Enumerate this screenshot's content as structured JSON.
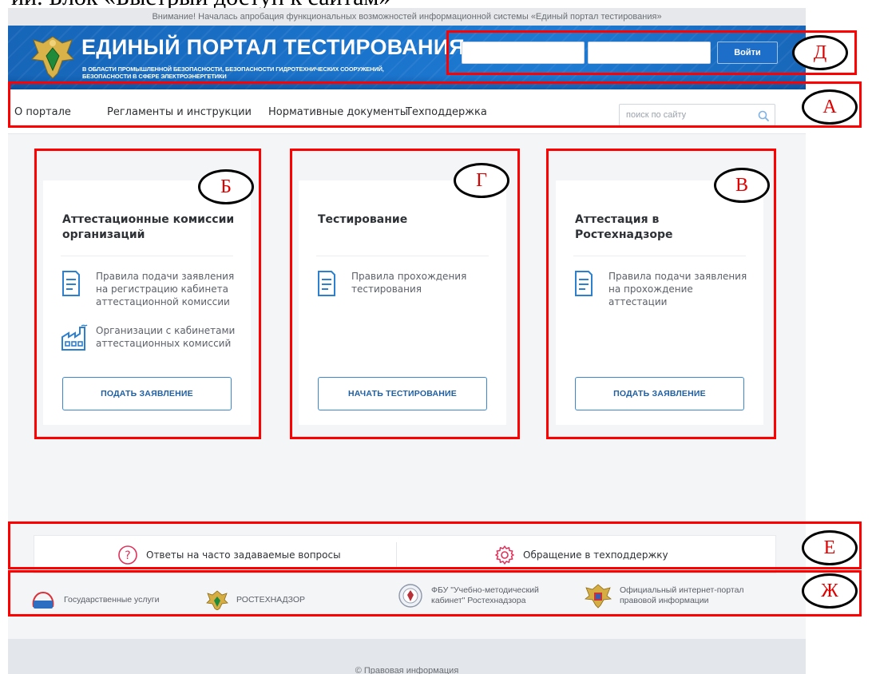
{
  "doc_caption": "ии. Блок «Быстрый доступ к сайтам»",
  "notice": "Внимание! Началась апробация функциональных возможностей информационной системы «Единый портал тестирования»",
  "header": {
    "title": "ЕДИНЫЙ ПОРТАЛ ТЕСТИРОВАНИЯ",
    "subtitle": "В ОБЛАСТИ ПРОМЫШЛЕННОЙ БЕЗОПАСНОСТИ, БЕЗОПАСНОСТИ ГИДРОТЕХНИЧЕСКИХ СООРУЖЕНИЙ, БЕЗОПАСНОСТИ В СФЕРЕ ЭЛЕКТРОЭНЕРГЕТИКИ",
    "login_button": "Войти"
  },
  "nav": {
    "items": [
      "О портале",
      "Регламенты и инструкции",
      "Нормативные документы",
      "Техподдержка"
    ],
    "search_placeholder": "поиск по сайту"
  },
  "cards": [
    {
      "title": "Аттестационные комиссии организаций",
      "links": [
        "Правила подачи заявления на регистрацию кабинета аттестационной комиссии",
        "Организации с кабинетами аттестационных комиссий"
      ],
      "button": "ПОДАТЬ ЗАЯВЛЕНИЕ"
    },
    {
      "title": "Тестирование",
      "links": [
        "Правила прохождения тестирования"
      ],
      "button": "НАЧАТЬ ТЕСТИРОВАНИЕ"
    },
    {
      "title": "Аттестация в Ростехнадзоре",
      "links": [
        "Правила подачи заявления на прохождение аттестации"
      ],
      "button": "ПОДАТЬ ЗАЯВЛЕНИЕ"
    }
  ],
  "help": {
    "faq": "Ответы на часто задаваемые вопросы",
    "support": "Обращение в техподдержку"
  },
  "partners": {
    "gosuslugi": "Государственные услуги",
    "gosuslugi_logo": "гос услуги",
    "rtn": "РОСТЕХНАДЗОР",
    "fbu": "ФБУ \"Учебно-методический кабинет\" Ростехнадзора",
    "pravo": "Официальный интернет-портал правовой информации"
  },
  "footer": "© Правовая информация",
  "annotations": {
    "d": "Д",
    "a": "А",
    "b": "Б",
    "g": "Г",
    "v": "В",
    "e": "Е",
    "zh": "Ж"
  },
  "colors": {
    "banner_blue": "#1b74cc",
    "accent_blue": "#3a86d0",
    "annotation_red": "#ff0000"
  }
}
